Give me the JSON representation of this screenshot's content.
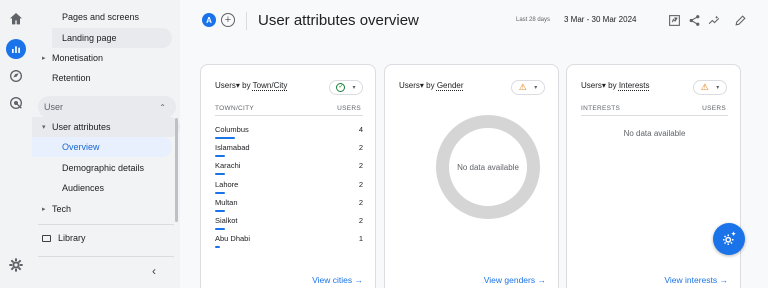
{
  "header": {
    "property_badge": "A",
    "title": "User attributes overview",
    "date_label": "Last 28 days",
    "date_range": "3 Mar - 30 Mar 2024"
  },
  "sidebar": {
    "items_top": [
      "Pages and screens",
      "Landing page",
      "Monetisation",
      "Retention"
    ],
    "section": "User",
    "user_attributes": "User attributes",
    "children": [
      "Overview",
      "Demographic details",
      "Audiences"
    ],
    "tech": "Tech",
    "library": "Library"
  },
  "cards": [
    {
      "metric": "Users",
      "by": "by",
      "dimension": "Town/City",
      "status": "ok",
      "col_left": "TOWN/CITY",
      "col_right": "USERS",
      "link": "View cities"
    },
    {
      "metric": "Users",
      "by": "by",
      "dimension": "Gender",
      "status": "warning",
      "nodata": "No data available",
      "link": "View genders"
    },
    {
      "metric": "Users",
      "by": "by",
      "dimension": "Interests",
      "status": "warning",
      "col_left": "INTERESTS",
      "col_right": "USERS",
      "nodata": "No data available",
      "link": "View interests"
    }
  ],
  "city_rows": [
    {
      "name": "Columbus",
      "users": "4",
      "frac": 1.0
    },
    {
      "name": "Islamabad",
      "users": "2",
      "frac": 0.5
    },
    {
      "name": "Karachi",
      "users": "2",
      "frac": 0.5
    },
    {
      "name": "Lahore",
      "users": "2",
      "frac": 0.5
    },
    {
      "name": "Multan",
      "users": "2",
      "frac": 0.5
    },
    {
      "name": "Sialkot",
      "users": "2",
      "frac": 0.5
    },
    {
      "name": "Abu Dhabi",
      "users": "1",
      "frac": 0.25
    }
  ],
  "colors": {
    "accent": "#1a73e8",
    "ok": "#188038",
    "warning": "#e37400"
  }
}
